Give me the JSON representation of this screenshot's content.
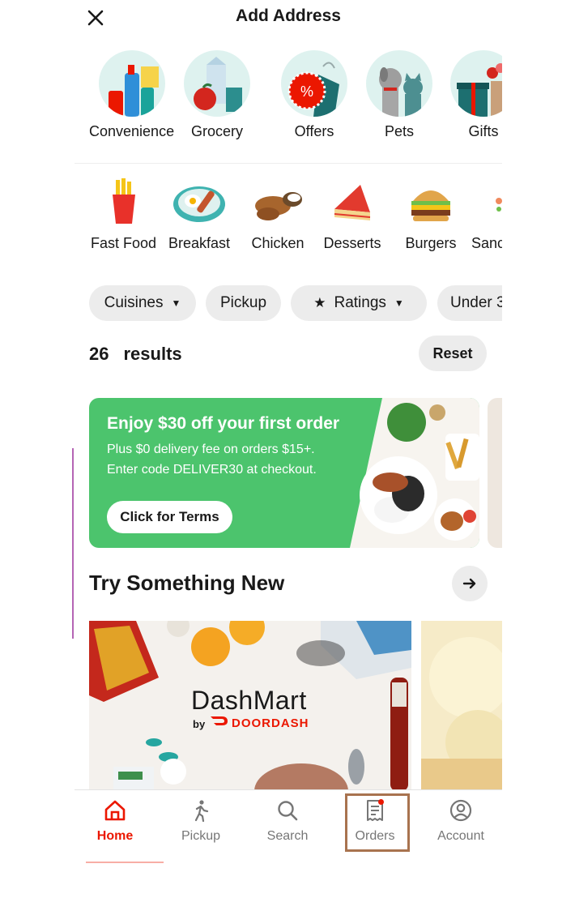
{
  "header": {
    "title": "Add Address"
  },
  "categories": [
    {
      "label": "Convenience",
      "icon": "convenience-icon"
    },
    {
      "label": "Grocery",
      "icon": "grocery-icon"
    },
    {
      "label": "Offers",
      "icon": "offers-icon"
    },
    {
      "label": "Pets",
      "icon": "pets-icon"
    },
    {
      "label": "Gifts",
      "icon": "gifts-icon"
    }
  ],
  "cuisines": [
    {
      "label": "Fast Food",
      "icon": "fries-icon"
    },
    {
      "label": "Breakfast",
      "icon": "breakfast-icon"
    },
    {
      "label": "Chicken",
      "icon": "chicken-icon"
    },
    {
      "label": "Desserts",
      "icon": "cake-icon"
    },
    {
      "label": "Burgers",
      "icon": "burger-icon"
    },
    {
      "label": "Sanc",
      "icon": "sandwich-icon"
    }
  ],
  "filters": [
    {
      "label": "Cuisines",
      "dropdown": true
    },
    {
      "label": "Pickup",
      "dropdown": false
    },
    {
      "label": "Ratings",
      "dropdown": true,
      "icon": "star-icon"
    },
    {
      "label": "Under 3",
      "dropdown": false
    }
  ],
  "results": {
    "count": "26",
    "label": "results",
    "reset_label": "Reset"
  },
  "promo": {
    "title": "Enjoy $30 off your first order",
    "line1": "Plus  $0 delivery fee on orders $15+.",
    "line2": "Enter code DELIVER30 at checkout.",
    "button_label": "Click for Terms",
    "color": "#4cc46d"
  },
  "section": {
    "title": "Try Something New"
  },
  "store_card": {
    "name": "DashMart",
    "by": "by",
    "brand": "DOORDASH"
  },
  "nav": [
    {
      "label": "Home",
      "icon": "home-icon",
      "active": true
    },
    {
      "label": "Pickup",
      "icon": "walking-icon",
      "active": false
    },
    {
      "label": "Search",
      "icon": "search-icon",
      "active": false
    },
    {
      "label": "Orders",
      "icon": "receipt-icon",
      "active": false
    },
    {
      "label": "Account",
      "icon": "account-icon",
      "active": false
    }
  ],
  "colors": {
    "brand_red": "#eb1700",
    "chip_bg": "#ececec",
    "category_circle": "#def2ef"
  }
}
